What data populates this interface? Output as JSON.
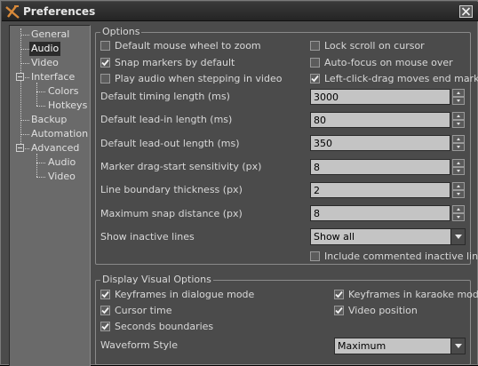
{
  "window": {
    "title": "Preferences"
  },
  "tree": {
    "general": "General",
    "audio": "Audio",
    "video": "Video",
    "interface": "Interface",
    "colors": "Colors",
    "hotkeys": "Hotkeys",
    "backup": "Backup",
    "automation": "Automation",
    "advanced": "Advanced",
    "adv_audio": "Audio",
    "adv_video": "Video",
    "selected": "Audio"
  },
  "options": {
    "title": "Options",
    "checks": [
      {
        "label": "Default mouse wheel to zoom",
        "checked": false
      },
      {
        "label": "Lock scroll on cursor",
        "checked": false
      },
      {
        "label": "Snap markers by default",
        "checked": true
      },
      {
        "label": "Auto-focus on mouse over",
        "checked": false
      },
      {
        "label": "Play audio when stepping in video",
        "checked": false
      },
      {
        "label": "Left-click-drag moves end marker",
        "checked": true
      }
    ],
    "fields": [
      {
        "label": "Default timing length (ms)",
        "value": "3000"
      },
      {
        "label": "Default lead-in length (ms)",
        "value": "80"
      },
      {
        "label": "Default lead-out length (ms)",
        "value": "350"
      },
      {
        "label": "Marker drag-start sensitivity (px)",
        "value": "8"
      },
      {
        "label": "Line boundary thickness (px)",
        "value": "2"
      },
      {
        "label": "Maximum snap distance (px)",
        "value": "8"
      }
    ],
    "inactive_label": "Show inactive lines",
    "inactive_value": "Show all",
    "commented_label": "Include commented inactive lines",
    "commented_checked": false
  },
  "display": {
    "title": "Display Visual Options",
    "checks": [
      {
        "label": "Keyframes in dialogue mode",
        "checked": true
      },
      {
        "label": "Keyframes in karaoke mode",
        "checked": true
      },
      {
        "label": "Cursor time",
        "checked": true
      },
      {
        "label": "Video position",
        "checked": true
      },
      {
        "label": "Seconds boundaries",
        "checked": true
      }
    ],
    "waveform_label": "Waveform Style",
    "waveform_value": "Maximum"
  }
}
